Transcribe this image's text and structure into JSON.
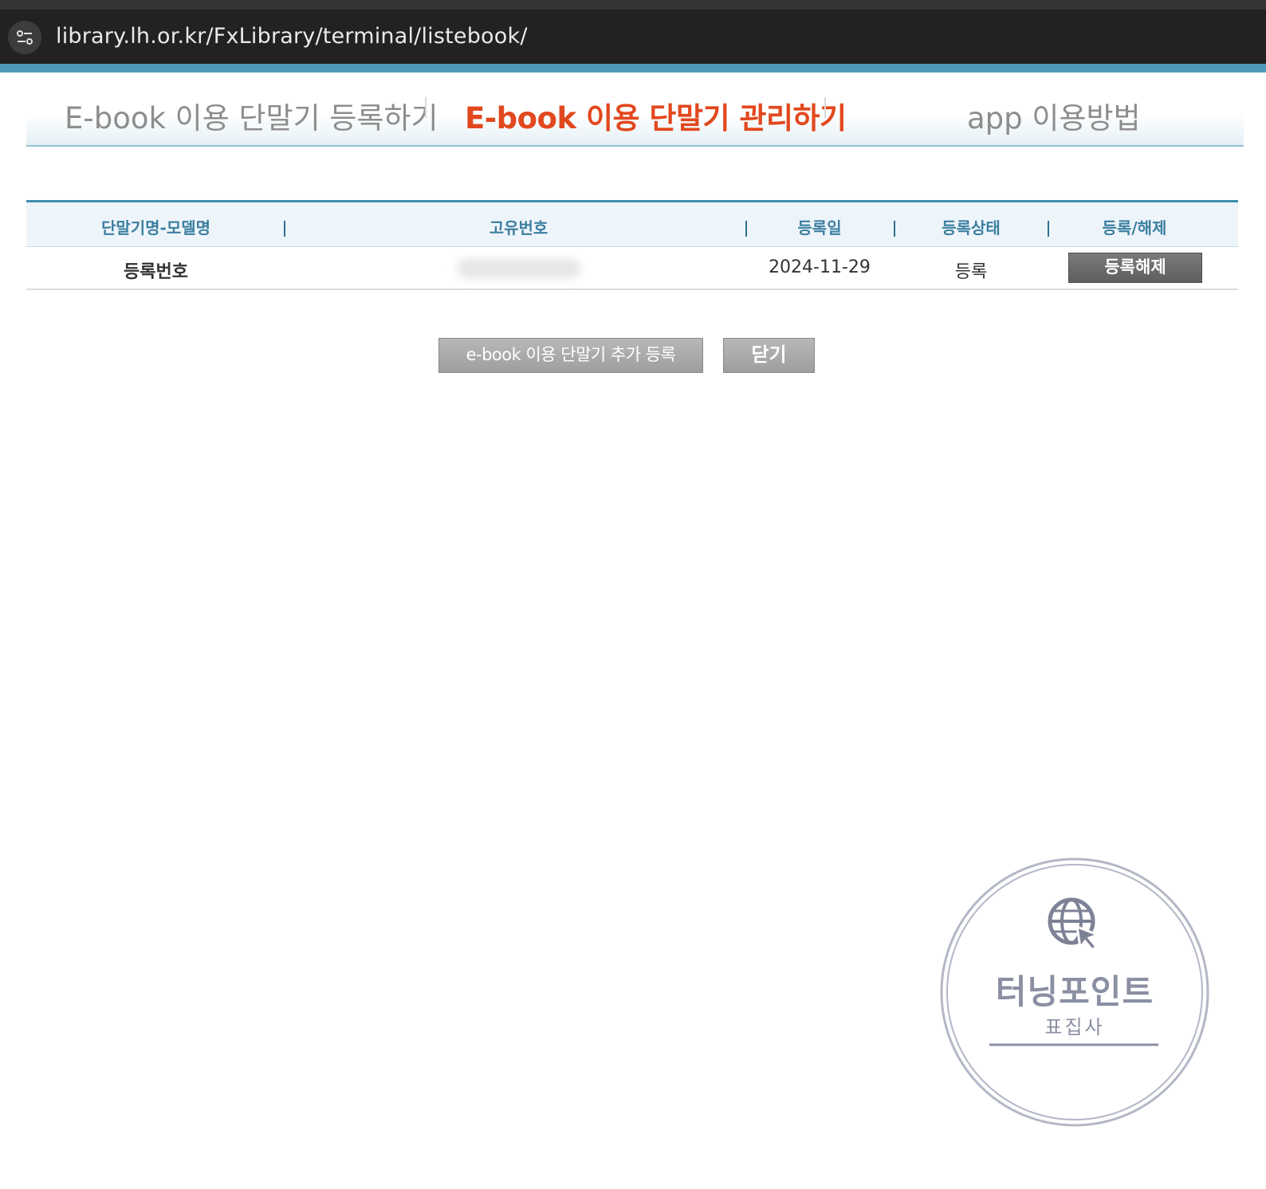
{
  "browser": {
    "url": "library.lh.or.kr/FxLibrary/terminal/listebook/"
  },
  "tabs": {
    "register": "E-book 이용 단말기 등록하기",
    "manage": "E-book 이용 단말기 관리하기",
    "app_guide": "app 이용방법"
  },
  "table": {
    "headers": [
      "단말기명-모델명",
      "고유번호",
      "등록일",
      "등록상태",
      "등록/해제"
    ],
    "rows": [
      {
        "device_name": "등록번호",
        "unique_id": "",
        "registered_date": "2024-11-29",
        "status": "등록",
        "action_label": "등록해제"
      }
    ]
  },
  "buttons": {
    "add_device": "e-book 이용 단말기 추가 등록",
    "close": "닫기"
  },
  "watermark": {
    "title": "터닝포인트",
    "subtitle": "표집사"
  },
  "colors": {
    "accent_bar": "#4e9bb8",
    "active_tab": "#e2481e",
    "header_text": "#3c7fa0"
  }
}
